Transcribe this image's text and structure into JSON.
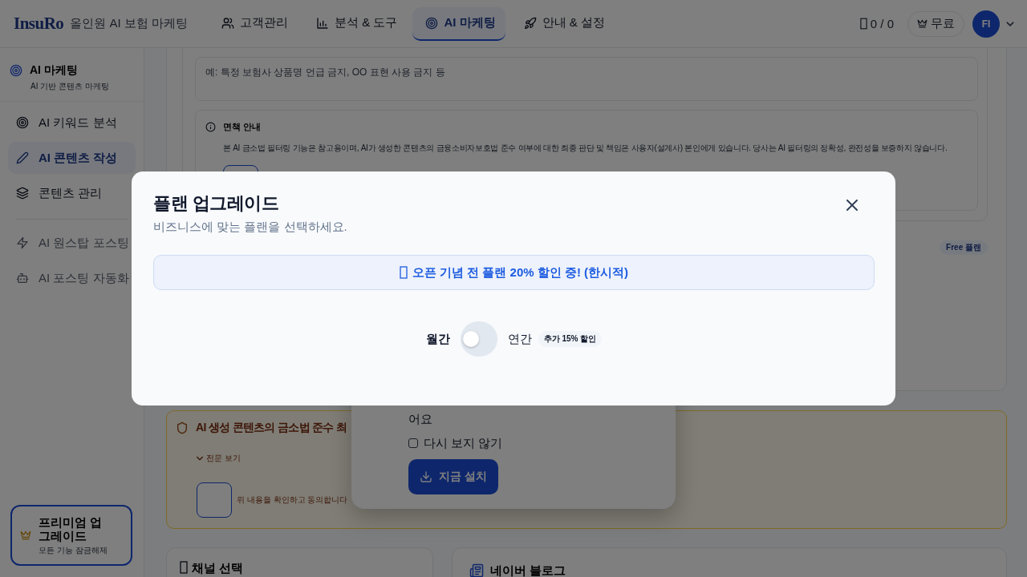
{
  "top_bar": {
    "logo": "InsuRo",
    "tagline": "올인원 AI 보험 마케팅",
    "nav_tabs": [
      {
        "label": "고객관리",
        "selected": false
      },
      {
        "label": "분석 & 도구",
        "selected": false
      },
      {
        "label": "AI 마케팅",
        "selected": true
      },
      {
        "label": "안내 & 설정",
        "selected": false
      }
    ],
    "credits": "0 / 0",
    "plan_badge": "무료",
    "avatar_initials": "FI"
  },
  "sidebar": {
    "title": "AI 마케팅",
    "subtitle": "AI 기반 콘텐츠 마케팅",
    "sections": [
      {
        "items": [
          {
            "label": "AI 키워드 분석",
            "selected": false,
            "disabled": false
          },
          {
            "label": "AI 콘텐츠 작성",
            "selected": true,
            "disabled": false
          },
          {
            "label": "콘텐츠 관리",
            "selected": false,
            "disabled": false
          }
        ]
      },
      {
        "items": [
          {
            "label": "AI 원스탑 포스팅",
            "selected": false,
            "disabled": true
          },
          {
            "label": "AI 포스팅 자동화",
            "selected": false,
            "disabled": true
          }
        ]
      }
    ],
    "upgrade_card": {
      "title": "프리미엄 업그레이드",
      "subtitle": "모든 기능 잠금해제"
    }
  },
  "content": {
    "exclusion_field": {
      "placeholder": "예: 특정 보험사 상품명 언급 금지, OO 표현 사용 금지 등"
    },
    "disclaimer": {
      "title": "면책 안내",
      "text": "본 AI 금소법 필터링 기능은 참고용이며, AI가 생성한 콘텐츠의 금융소비자보호법 준수 여부에 대한 최종 판단 및 책임은 사용자(설계사) 본인에게 있습니다. 당사는 AI 필터링의 정확성, 완전성을 보증하지 않습니다.",
      "checked": false
    },
    "plan_badge": "Free 플랜",
    "compliance": {
      "title": "AI 생성 콘텐츠의 금소법 준수 최",
      "expand_label": "전문 보기",
      "checked": false,
      "agree_label": "위 내용을 확인하고 동의합니다"
    },
    "channel_card": {
      "title": "채널 선택"
    },
    "blog_card": {
      "title": "네이버 블로그"
    }
  },
  "install_prompt": {
    "text": "어요",
    "dont_show_again": {
      "label": "다시 보지 않기",
      "checked": false
    },
    "install_button": "지금 설치"
  },
  "modal": {
    "title": "플랜 업그레이드",
    "subtitle": "비즈니스에 맞는 플랜을 선택하세요.",
    "promo": "오픈 기념 전 플랜 20% 할인 중! (한시적)",
    "billing": {
      "monthly_label": "월간",
      "annual_label": "연간",
      "annual": false,
      "annual_badge": "추가 15% 할인"
    }
  }
}
